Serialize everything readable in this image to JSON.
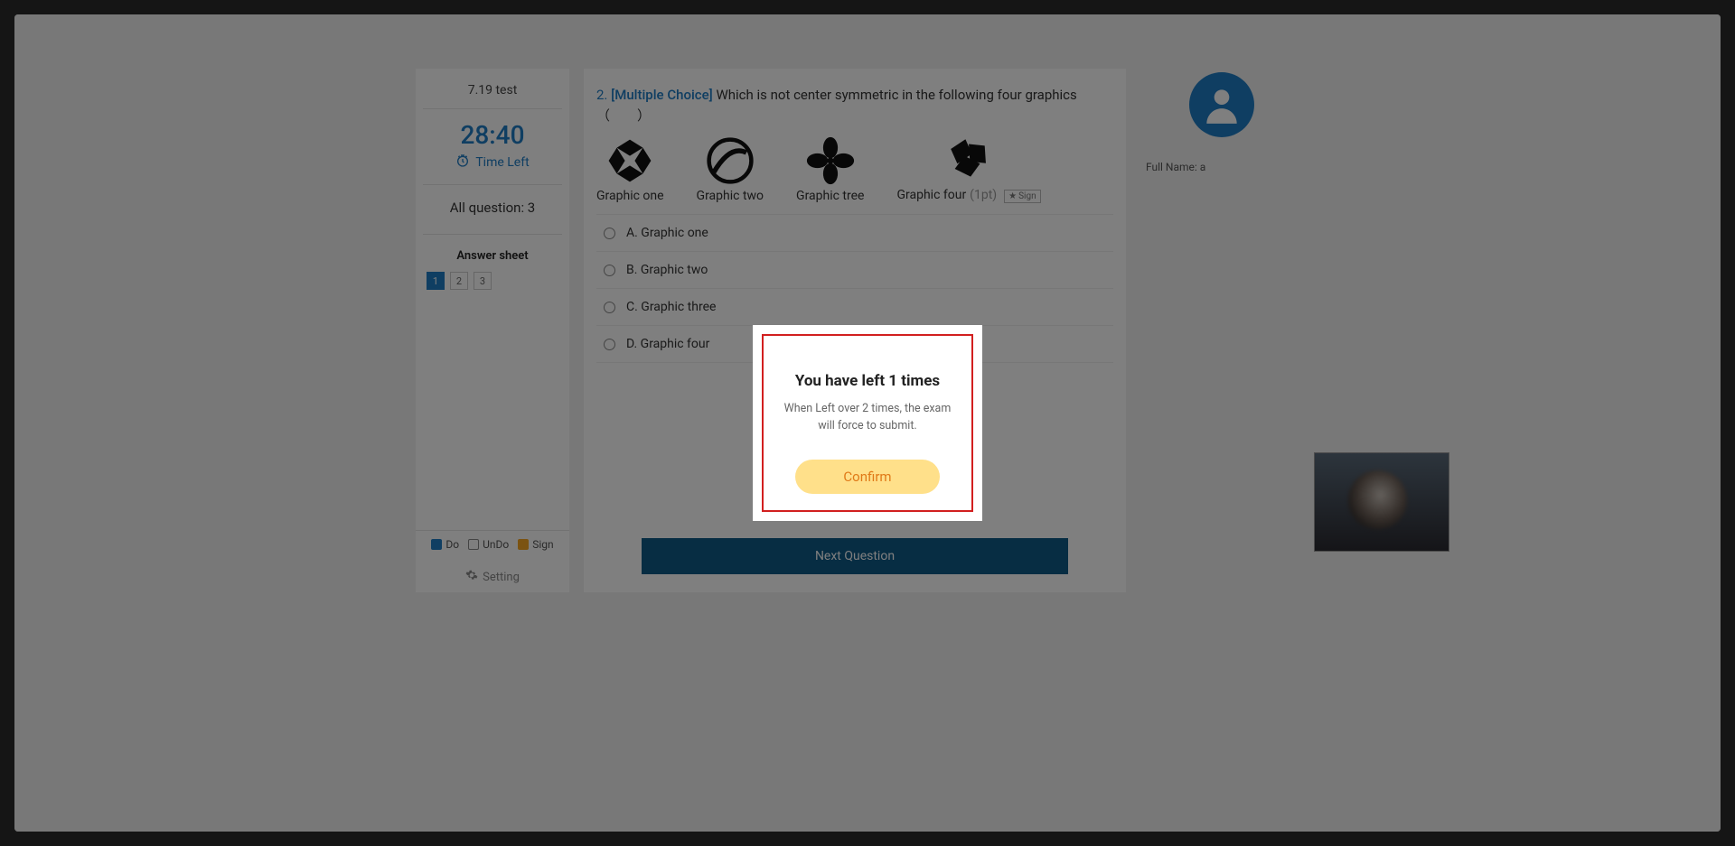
{
  "sidebar": {
    "test_title": "7.19 test",
    "timer": "28:40",
    "time_left_label": "Time Left",
    "all_question_label": "All question: 3",
    "answer_sheet_label": "Answer sheet",
    "qboxes": [
      "1",
      "2",
      "3"
    ],
    "legend": {
      "do": "Do",
      "undo": "UnDo",
      "sign": "Sign"
    },
    "setting_label": "Setting"
  },
  "question": {
    "number": "2.",
    "type": "[Multiple Choice]",
    "text": "Which is not center symmetric in the following four graphics（　　）",
    "graphics": [
      {
        "label": "Graphic one"
      },
      {
        "label": "Graphic two"
      },
      {
        "label": "Graphic tree"
      },
      {
        "label": "Graphic four"
      }
    ],
    "points": "(1pt)",
    "sign_label": "Sign",
    "options": [
      "A. Graphic one",
      "B. Graphic two",
      "C. Graphic three",
      "D. Graphic four"
    ],
    "next_button": "Next Question"
  },
  "profile": {
    "full_name_label": "Full Name:",
    "full_name_value": "a"
  },
  "modal": {
    "title": "You have left 1 times",
    "message": "When Left over 2 times, the exam will force to submit.",
    "confirm": "Confirm"
  }
}
